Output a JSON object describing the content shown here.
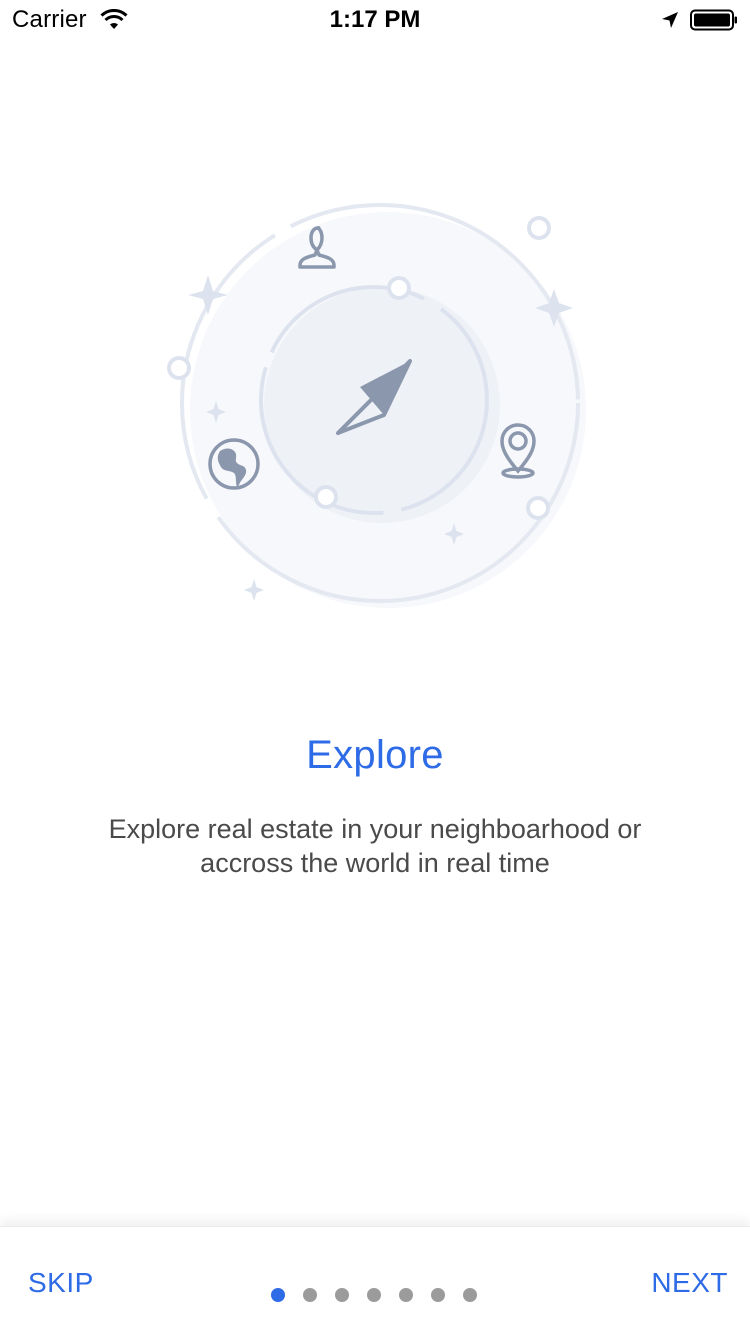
{
  "status_bar": {
    "carrier": "Carrier",
    "time": "1:17 PM",
    "icons": [
      "wifi-icon",
      "location-arrow-icon",
      "battery-icon"
    ]
  },
  "onboarding": {
    "title": "Explore",
    "description_line1": "Explore real estate in your neighboarhood or",
    "description_line2": "accross the world in real time",
    "illustration_icons": [
      "compass-icon",
      "person-icon",
      "globe-icon",
      "map-pin-icon",
      "sparkle-icon"
    ]
  },
  "footer": {
    "skip_label": "SKIP",
    "next_label": "NEXT",
    "page_count": 7,
    "active_page": 1
  },
  "colors": {
    "accent": "#2e6be6",
    "text": "#4a4a4a",
    "dot_inactive": "#9b9b9b",
    "illustration_stroke": "#dde3ee",
    "illustration_icon": "#8b97ad"
  }
}
